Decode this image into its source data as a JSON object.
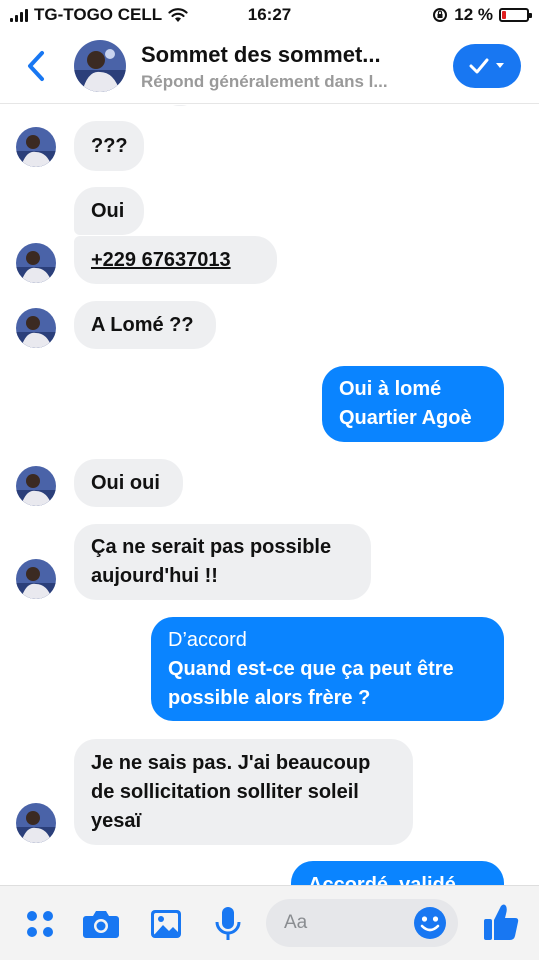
{
  "status_bar": {
    "carrier": "TG-TOGO CELL",
    "time": "16:27",
    "battery": "12 %"
  },
  "header": {
    "title": "Sommet des sommet...",
    "subtitle": "Répond généralement dans l..."
  },
  "messages": [
    {
      "side": "in",
      "lines": [
        "???"
      ]
    },
    {
      "side": "in",
      "lines": [
        "Oui"
      ]
    },
    {
      "side": "in",
      "lines": [
        "+229 67637013"
      ],
      "link": true
    },
    {
      "side": "in",
      "lines": [
        "A Lomé ??"
      ]
    },
    {
      "side": "out",
      "lines": [
        "Oui à lomé",
        "Quartier Agoè"
      ]
    },
    {
      "side": "in",
      "lines": [
        "Oui oui"
      ]
    },
    {
      "side": "in",
      "lines": [
        "Ça ne serait pas possible",
        "aujourd'hui !!"
      ]
    },
    {
      "side": "out",
      "lines": [
        "D’accord",
        "Quand est-ce que ça peut être",
        "possible alors frère ?"
      ]
    },
    {
      "side": "in",
      "lines": [
        "Je ne sais pas. J'ai beaucoup",
        "de sollicitation solliter soleil",
        "yesaï"
      ]
    },
    {
      "side": "out",
      "lines": [
        "Accordé, validé"
      ],
      "partial": true
    }
  ],
  "composer": {
    "placeholder": "Aa"
  },
  "colors": {
    "accent": "#1877f2",
    "outgoing_bubble": "#0a84ff",
    "incoming_bubble": "#eeeff1",
    "battery_low": "#e02020"
  },
  "icons": [
    "back-chevron-icon",
    "check-dropdown-icon",
    "apps-grid-icon",
    "camera-icon",
    "image-icon",
    "microphone-icon",
    "emoji-icon",
    "thumbs-up-icon"
  ]
}
